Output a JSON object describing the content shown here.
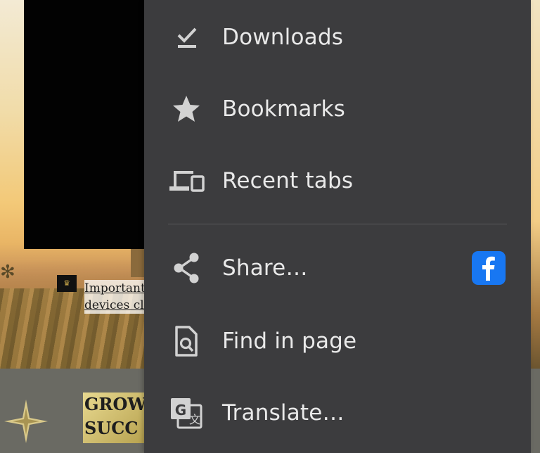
{
  "background_page": {
    "notice_lines": [
      "Important",
      "devices cli"
    ],
    "badge_lines": [
      "GROW",
      "SUCC"
    ]
  },
  "menu": {
    "items": [
      {
        "label": "Downloads",
        "icon": "download-done-icon"
      },
      {
        "label": "Bookmarks",
        "icon": "star-icon"
      },
      {
        "label": "Recent tabs",
        "icon": "devices-icon"
      },
      {
        "label": "Share…",
        "icon": "share-icon",
        "shortcut_app": "facebook-icon"
      },
      {
        "label": "Find in page",
        "icon": "find-in-page-icon"
      },
      {
        "label": "Translate…",
        "icon": "translate-icon"
      }
    ]
  },
  "colors": {
    "menu_background": "#3c3c3e",
    "menu_text": "#e9e9e9",
    "icon_color": "#d2d2d2",
    "facebook_blue": "#1877f2"
  }
}
